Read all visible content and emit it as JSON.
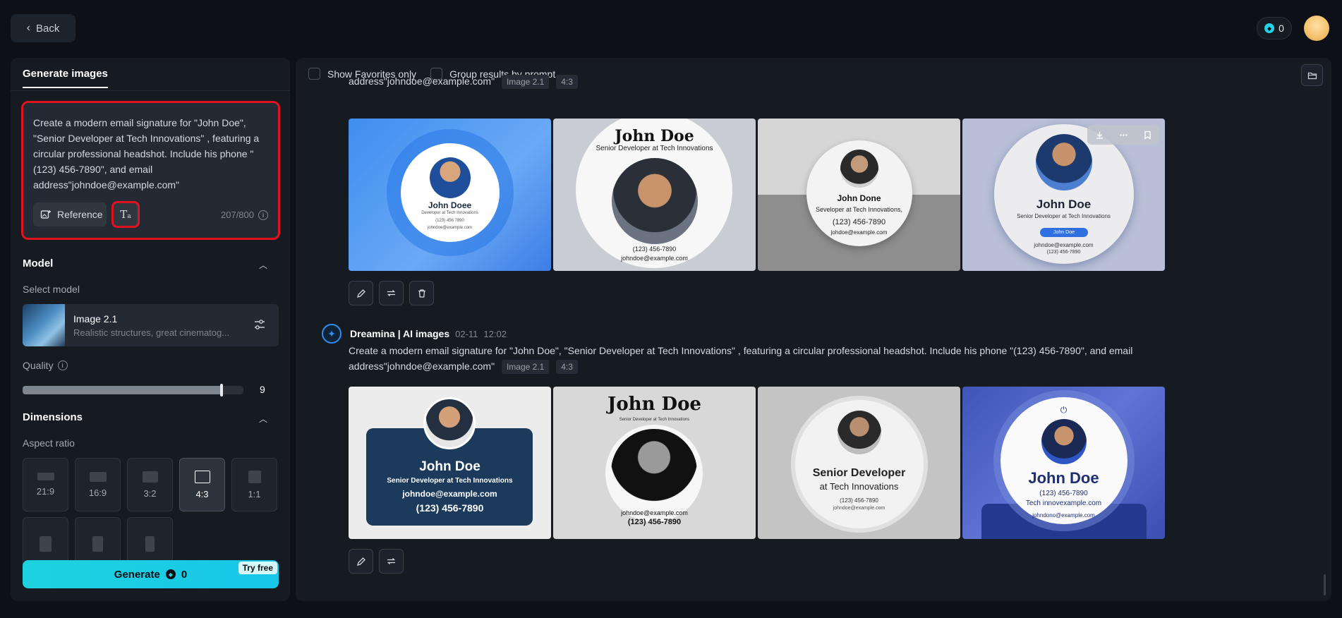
{
  "header": {
    "back_label": "Back",
    "credits": "0"
  },
  "left": {
    "tab_label": "Generate images",
    "prompt_text": "Create a modern email signature for \"John Doe\", \"Senior Developer at Tech Innovations\" , featuring a circular professional headshot. Include his phone \"(123) 456-7890\", and email address\"johndoe@example.com\"",
    "reference_label": "Reference",
    "char_count": "207/800",
    "model_section": "Model",
    "select_model_label": "Select model",
    "model_name": "Image 2.1",
    "model_desc": "Realistic structures, great cinematog...",
    "quality_label": "Quality",
    "quality_value": "9",
    "quality_level": 0.9,
    "dimensions_section": "Dimensions",
    "aspect_label": "Aspect ratio",
    "aspect_options": [
      "21:9",
      "16:9",
      "3:2",
      "4:3",
      "1:1"
    ],
    "selected_aspect": "4:3",
    "generate_label": "Generate",
    "generate_cost": "0",
    "try_free": "Try free"
  },
  "right": {
    "show_favorites": "Show Favorites only",
    "group_results": "Group results by prompt",
    "group1": {
      "prompt_tail": "address\"johndoe@example.com\"",
      "model_tag": "Image 2.1",
      "ratio_tag": "4:3"
    },
    "group2": {
      "author": "Dreamina | AI images",
      "date": "02-11",
      "time": "12:02",
      "prompt_line1": "Create a modern email signature for \"John Doe\", \"Senior Developer at Tech Innovations\" , featuring a circular professional headshot. Include his phone \"(123) 456-7890\", and email",
      "prompt_line2": "address\"johndoe@example.com\"",
      "model_tag": "Image 2.1",
      "ratio_tag": "4:3"
    },
    "cards1": [
      {
        "name": "John Doee",
        "l1": "Developer at Tech Innovations",
        "l2": "(123) 456 7890",
        "l3": "johndoe@example.com"
      },
      {
        "name": "John Doe",
        "l1": "Senior Developer at Tech Innovations",
        "l2": "(123) 456-7890",
        "l3": "johndoe@example.com"
      },
      {
        "name": "John Done",
        "l1": "Seveloper at Tech Innovations,",
        "l2": "(123) 456-7890",
        "l3": "johdoe@example.com"
      },
      {
        "name": "John Doe",
        "l1": "Senior Developer at Tech Innovations",
        "l2": "John Doe",
        "l3": "johndoe@example.com",
        "l4": "(123) 456-7890"
      }
    ],
    "cards2": [
      {
        "name": "John Doe",
        "l1": "Senior Developer at Tech Innovations",
        "l2": "johndoe@example.com",
        "l3": "(123) 456-7890"
      },
      {
        "name": "John Doe",
        "l1": "Senior Developer at Tech Innovations",
        "l2": "johndoe@example.com",
        "l3": "(123) 456-7890"
      },
      {
        "name": "Senior Developer",
        "l1": "at Tech Innovations",
        "l2": "(123) 456-7890",
        "l3": "johndoe@example.com"
      },
      {
        "name": "John Doe",
        "l1": "(123) 456-7890",
        "l2": "Tech innovexample.com",
        "l3": "johndono@example.com"
      }
    ]
  },
  "colors": {
    "accent": "#1ed2df",
    "highlight": "#e0121f",
    "background": "#0d1117",
    "panel": "#161b22"
  },
  "icons": [
    "chevron-left-icon",
    "coin-icon",
    "reference-icon",
    "text-icon",
    "info-icon",
    "chevron-up-icon",
    "settings-sliders-icon",
    "folder-icon",
    "edit-icon",
    "regenerate-icon",
    "trash-icon",
    "download-icon",
    "more-icon",
    "bookmark-icon",
    "dreamina-logo-icon"
  ]
}
